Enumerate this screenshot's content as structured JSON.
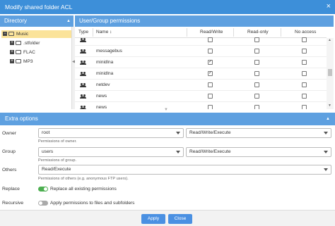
{
  "window": {
    "title": "Modify shared folder ACL",
    "close_glyph": "×"
  },
  "directory": {
    "header": "Directory",
    "items": [
      {
        "label": "Music",
        "expander": "−",
        "selected": true
      },
      {
        "label": ".stfolder",
        "expander": "+",
        "selected": false
      },
      {
        "label": "FLAC",
        "expander": "+",
        "selected": false
      },
      {
        "label": "MP3",
        "expander": "+",
        "selected": false
      }
    ]
  },
  "permissions": {
    "header": "User/Group permissions",
    "columns": {
      "type": "Type",
      "name": "Name",
      "sort_glyph": "↕",
      "rw": "Read/Write",
      "ro": "Read-only",
      "na": "No access"
    },
    "rows": [
      {
        "name": "",
        "rw": false,
        "ro": false,
        "na": false
      },
      {
        "name": "messagebus",
        "rw": false,
        "ro": false,
        "na": false
      },
      {
        "name": "minidlna",
        "rw": true,
        "ro": false,
        "na": false
      },
      {
        "name": "minidlna",
        "rw": true,
        "ro": false,
        "na": false
      },
      {
        "name": "netdev",
        "rw": false,
        "ro": false,
        "na": false
      },
      {
        "name": "news",
        "rw": false,
        "ro": false,
        "na": false
      },
      {
        "name": "news",
        "rw": false,
        "ro": false,
        "na": false
      }
    ]
  },
  "extra": {
    "header": "Extra options",
    "owner": {
      "label": "Owner",
      "user": "root",
      "perm": "Read/Write/Execute",
      "hint": "Permissions of owner."
    },
    "group": {
      "label": "Group",
      "user": "users",
      "perm": "Read/Write/Execute",
      "hint": "Permissions of group."
    },
    "others": {
      "label": "Others",
      "perm": "Read/Execute",
      "hint": "Permissions of others (e.g. anonymous FTP users)."
    },
    "replace": {
      "label": "Replace",
      "text": "Replace all existing permissions",
      "on": true
    },
    "recursive": {
      "label": "Recursive",
      "text": "Apply permissions to files and subfolders",
      "on": false
    }
  },
  "buttons": {
    "apply": "Apply",
    "close": "Close"
  },
  "colors": {
    "titlebar": "#3d8fd9",
    "panel_header": "#5ea0e0",
    "selected_row": "#fbe39a",
    "toggle_on": "#4caf50",
    "button": "#4a90e2"
  }
}
